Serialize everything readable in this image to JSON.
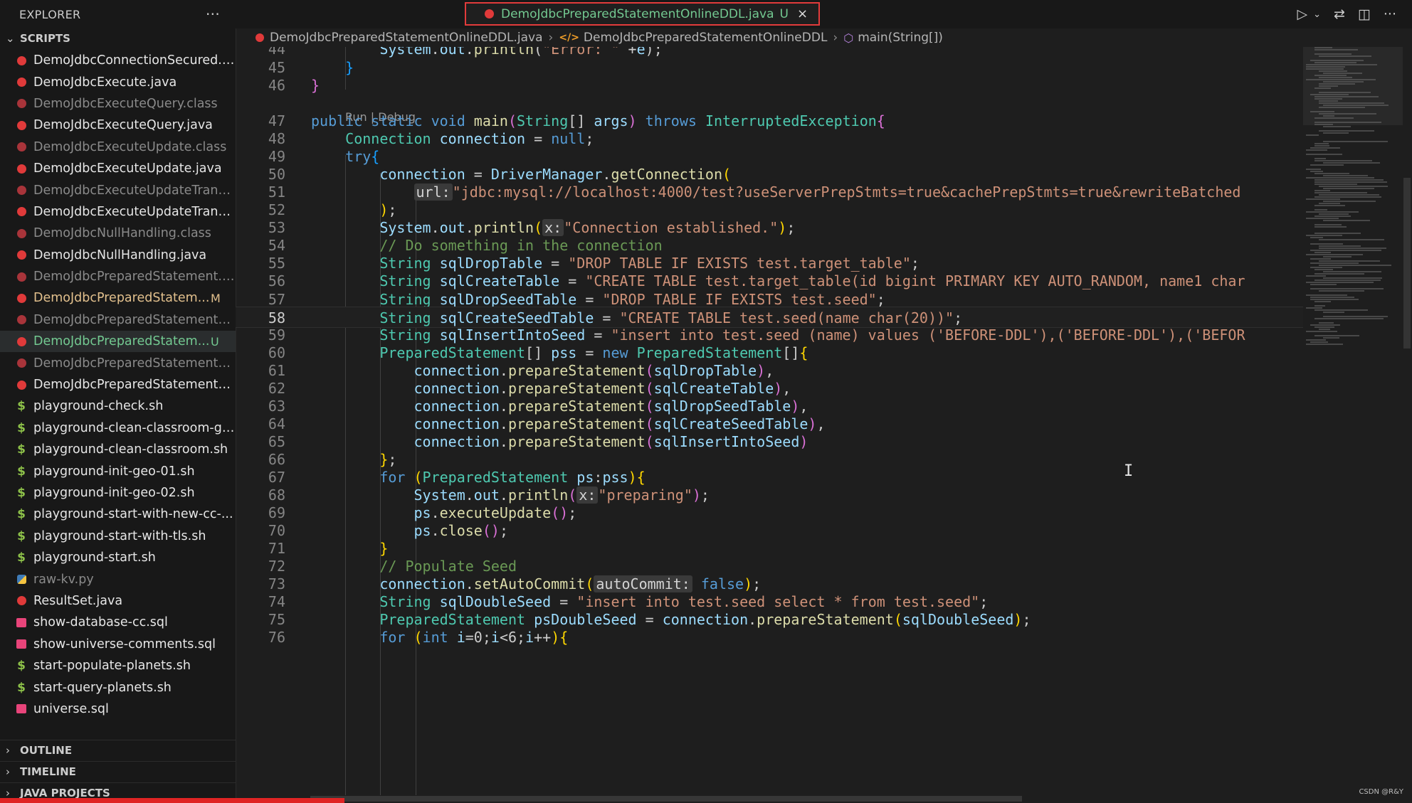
{
  "sidebar": {
    "title": "EXPLORER",
    "more_icon": "ellipsis-icon",
    "section": "SCRIPTS",
    "files": [
      {
        "name": "DemoJdbcConnectionSecured.j...",
        "type": "java",
        "color": "white",
        "badge": ""
      },
      {
        "name": "DemoJdbcExecute.java",
        "type": "java",
        "color": "white",
        "badge": ""
      },
      {
        "name": "DemoJdbcExecuteQuery.class",
        "type": "class",
        "color": "dim",
        "badge": ""
      },
      {
        "name": "DemoJdbcExecuteQuery.java",
        "type": "java",
        "color": "white",
        "badge": ""
      },
      {
        "name": "DemoJdbcExecuteUpdate.class",
        "type": "class",
        "color": "dim",
        "badge": ""
      },
      {
        "name": "DemoJdbcExecuteUpdate.java",
        "type": "java",
        "color": "white",
        "badge": ""
      },
      {
        "name": "DemoJdbcExecuteUpdateTrans...",
        "type": "class",
        "color": "dim",
        "badge": ""
      },
      {
        "name": "DemoJdbcExecuteUpdateTrans...",
        "type": "java",
        "color": "white",
        "badge": ""
      },
      {
        "name": "DemoJdbcNullHandling.class",
        "type": "class",
        "color": "dim",
        "badge": ""
      },
      {
        "name": "DemoJdbcNullHandling.java",
        "type": "java",
        "color": "white",
        "badge": ""
      },
      {
        "name": "DemoJdbcPreparedStatement.c...",
        "type": "class",
        "color": "dim",
        "badge": ""
      },
      {
        "name": "DemoJdbcPreparedStatem...",
        "type": "java",
        "color": "mod",
        "badge": "M"
      },
      {
        "name": "DemoJdbcPreparedStatementO...",
        "type": "class",
        "color": "dim",
        "badge": ""
      },
      {
        "name": "DemoJdbcPreparedStatem...",
        "type": "java",
        "color": "new",
        "badge": "U",
        "selected": true
      },
      {
        "name": "DemoJdbcPreparedStatementW...",
        "type": "class",
        "color": "dim",
        "badge": ""
      },
      {
        "name": "DemoJdbcPreparedStatementW...",
        "type": "java",
        "color": "white",
        "badge": ""
      },
      {
        "name": "playground-check.sh",
        "type": "sh",
        "color": "white",
        "badge": ""
      },
      {
        "name": "playground-clean-classroom-ge...",
        "type": "sh",
        "color": "white",
        "badge": ""
      },
      {
        "name": "playground-clean-classroom.sh",
        "type": "sh",
        "color": "white",
        "badge": ""
      },
      {
        "name": "playground-init-geo-01.sh",
        "type": "sh",
        "color": "white",
        "badge": ""
      },
      {
        "name": "playground-init-geo-02.sh",
        "type": "sh",
        "color": "white",
        "badge": ""
      },
      {
        "name": "playground-start-with-new-cc-...",
        "type": "sh",
        "color": "white",
        "badge": ""
      },
      {
        "name": "playground-start-with-tls.sh",
        "type": "sh",
        "color": "white",
        "badge": ""
      },
      {
        "name": "playground-start.sh",
        "type": "sh",
        "color": "white",
        "badge": ""
      },
      {
        "name": "raw-kv.py",
        "type": "py",
        "color": "dim",
        "badge": ""
      },
      {
        "name": "ResultSet.java",
        "type": "java",
        "color": "white",
        "badge": ""
      },
      {
        "name": "show-database-cc.sql",
        "type": "sql",
        "color": "white",
        "badge": ""
      },
      {
        "name": "show-universe-comments.sql",
        "type": "sql",
        "color": "white",
        "badge": ""
      },
      {
        "name": "start-populate-planets.sh",
        "type": "sh",
        "color": "white",
        "badge": ""
      },
      {
        "name": "start-query-planets.sh",
        "type": "sh",
        "color": "white",
        "badge": ""
      },
      {
        "name": "universe.sql",
        "type": "sql",
        "color": "white",
        "badge": ""
      }
    ],
    "bottom_sections": [
      "OUTLINE",
      "TIMELINE",
      "JAVA PROJECTS"
    ]
  },
  "tab": {
    "label": "DemoJdbcPreparedStatementOnlineDDL.java",
    "badge": "U",
    "close": "×"
  },
  "toolbar_icons": [
    "run-icon",
    "dropdown-chevron-icon",
    "compare-changes-icon",
    "split-editor-icon",
    "more-actions-icon"
  ],
  "breadcrumb": {
    "file": "DemoJdbcPreparedStatementOnlineDDL.java",
    "class": "DemoJdbcPreparedStatementOnlineDDL",
    "method": "main(String[])"
  },
  "codelens": "Run | Debug",
  "code_lines": [
    {
      "n": "44",
      "html": "        <span class=\"var\">System</span>.<span class=\"var\">out</span>.<span class=\"fn\">println</span>(<span class=\"st\">\"Error: \"</span> +<span class=\"var\">e</span>);"
    },
    {
      "n": "45",
      "html": "    <span class=\"br3\">}</span>"
    },
    {
      "n": "46",
      "html": "<span class=\"br2\">}</span>"
    },
    {
      "n": "47",
      "html": "<span class=\"kw\">public static void</span> <span class=\"fn\">main</span><span class=\"br2\">(</span><span class=\"ty\">String</span>[] <span class=\"var\">args</span><span class=\"br2\">)</span> <span class=\"kw\">throws</span> <span class=\"ty\">InterruptedException</span><span class=\"br2\">{</span>"
    },
    {
      "n": "48",
      "html": "    <span class=\"ty\">Connection</span> <span class=\"var\">connection</span> = <span class=\"kw\">null</span>;"
    },
    {
      "n": "49",
      "html": "    <span class=\"kw\">try</span><span class=\"br3\">{</span>"
    },
    {
      "n": "50",
      "html": "        <span class=\"var\">connection</span> = <span class=\"var\">DriverManager</span>.<span class=\"fn\">getConnection</span><span class=\"br\">(</span>"
    },
    {
      "n": "51",
      "html": "            <span class=\"hint\">url:</span><span class=\"st\">\"jdbc:mysql://localhost:4000/test?useServerPrepStmts=true&amp;cachePrepStmts=true&amp;rewriteBatched</span>"
    },
    {
      "n": "52",
      "html": "        <span class=\"br\">)</span>;"
    },
    {
      "n": "53",
      "html": "        <span class=\"var\">System</span>.<span class=\"var\">out</span>.<span class=\"fn\">println</span><span class=\"br\">(</span><span class=\"hint\">x:</span><span class=\"st\">\"Connection established.\"</span><span class=\"br\">)</span>;"
    },
    {
      "n": "54",
      "html": "        <span class=\"cm\">// Do something in the connection</span>"
    },
    {
      "n": "55",
      "html": "        <span class=\"ty\">String</span> <span class=\"var\">sqlDropTable</span> = <span class=\"st\">\"DROP TABLE IF EXISTS test.target_table\"</span>;"
    },
    {
      "n": "56",
      "html": "        <span class=\"ty\">String</span> <span class=\"var\">sqlCreateTable</span> = <span class=\"st\">\"CREATE TABLE test.target_table(id bigint PRIMARY KEY AUTO_RANDOM, name1 char</span>"
    },
    {
      "n": "57",
      "html": "        <span class=\"ty\">String</span> <span class=\"var\">sqlDropSeedTable</span> = <span class=\"st\">\"DROP TABLE IF EXISTS test.seed\"</span>;"
    },
    {
      "n": "58",
      "html": "        <span class=\"ty\">String</span> <span class=\"var\">sqlCreateSeedTable</span> = <span class=\"st\">\"CREATE TABLE test.seed(name char(20))\"</span>;",
      "current": true
    },
    {
      "n": "59",
      "html": "        <span class=\"ty\">String</span> <span class=\"var\">sqlInsertIntoSeed</span> = <span class=\"st\">\"insert into test.seed (name) values ('BEFORE-DDL'),('BEFORE-DDL'),('BEFOR</span>"
    },
    {
      "n": "60",
      "html": "        <span class=\"ty\">PreparedStatement</span>[] <span class=\"var\">pss</span> = <span class=\"kw\">new</span> <span class=\"ty\">PreparedStatement</span>[]<span class=\"br\">{</span>"
    },
    {
      "n": "61",
      "html": "            <span class=\"var\">connection</span>.<span class=\"fn\">prepareStatement</span><span class=\"br2\">(</span><span class=\"var\">sqlDropTable</span><span class=\"br2\">)</span>,"
    },
    {
      "n": "62",
      "html": "            <span class=\"var\">connection</span>.<span class=\"fn\">prepareStatement</span><span class=\"br2\">(</span><span class=\"var\">sqlCreateTable</span><span class=\"br2\">)</span>,"
    },
    {
      "n": "63",
      "html": "            <span class=\"var\">connection</span>.<span class=\"fn\">prepareStatement</span><span class=\"br2\">(</span><span class=\"var\">sqlDropSeedTable</span><span class=\"br2\">)</span>,"
    },
    {
      "n": "64",
      "html": "            <span class=\"var\">connection</span>.<span class=\"fn\">prepareStatement</span><span class=\"br2\">(</span><span class=\"var\">sqlCreateSeedTable</span><span class=\"br2\">)</span>,"
    },
    {
      "n": "65",
      "html": "            <span class=\"var\">connection</span>.<span class=\"fn\">prepareStatement</span><span class=\"br2\">(</span><span class=\"var\">sqlInsertIntoSeed</span><span class=\"br2\">)</span>"
    },
    {
      "n": "66",
      "html": "        <span class=\"br\">}</span>;"
    },
    {
      "n": "67",
      "html": "        <span class=\"kw\">for</span> <span class=\"br\">(</span><span class=\"ty\">PreparedStatement</span> <span class=\"var\">ps</span>:<span class=\"var\">pss</span><span class=\"br\">)</span><span class=\"br\">{</span>"
    },
    {
      "n": "68",
      "html": "            <span class=\"var\">System</span>.<span class=\"var\">out</span>.<span class=\"fn\">println</span><span class=\"br2\">(</span><span class=\"hint\">x:</span><span class=\"st\">\"preparing\"</span><span class=\"br2\">)</span>;"
    },
    {
      "n": "69",
      "html": "            <span class=\"var\">ps</span>.<span class=\"fn\">executeUpdate</span><span class=\"br2\">()</span>;"
    },
    {
      "n": "70",
      "html": "            <span class=\"var\">ps</span>.<span class=\"fn\">close</span><span class=\"br2\">()</span>;"
    },
    {
      "n": "71",
      "html": "        <span class=\"br\">}</span>"
    },
    {
      "n": "72",
      "html": "        <span class=\"cm\">// Populate Seed</span>"
    },
    {
      "n": "73",
      "html": "        <span class=\"var\">connection</span>.<span class=\"fn\">setAutoCommit</span><span class=\"br\">(</span><span class=\"hint\">autoCommit:</span> <span class=\"kw\">false</span><span class=\"br\">)</span>;"
    },
    {
      "n": "74",
      "html": "        <span class=\"ty\">String</span> <span class=\"var\">sqlDoubleSeed</span> = <span class=\"st\">\"insert into test.seed select * from test.seed\"</span>;"
    },
    {
      "n": "75",
      "html": "        <span class=\"ty\">PreparedStatement</span> <span class=\"var\">psDoubleSeed</span> = <span class=\"var\">connection</span>.<span class=\"fn\">prepareStatement</span><span class=\"br\">(</span><span class=\"var\">sqlDoubleSeed</span><span class=\"br\">)</span>;"
    },
    {
      "n": "76",
      "html": "        <span class=\"kw\">for</span> <span class=\"br\">(</span><span class=\"kw\">int</span> <span class=\"var\">i</span>=0;<span class=\"var\">i</span>&lt;6;<span class=\"var\">i</span>++<span class=\"br\">)</span><span class=\"br\">{</span>"
    }
  ],
  "video_progress": 0.244,
  "watermark": "CSDN @R&Y",
  "colors": {
    "accent_tab_border": "#e23b3b",
    "untracked": "#73c991",
    "modified": "#e2c08d"
  }
}
